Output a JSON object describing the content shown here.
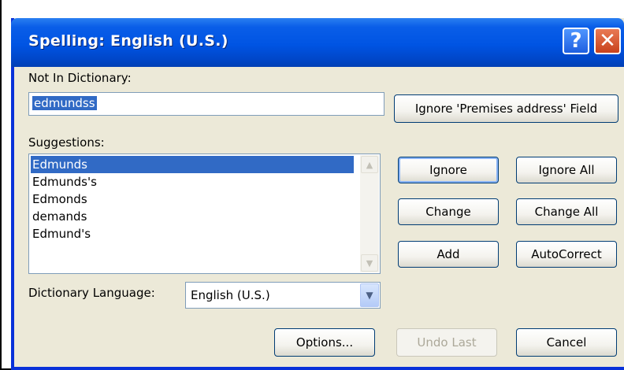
{
  "window": {
    "title": "Spelling: English (U.S.)",
    "help_glyph": "?",
    "close_glyph": "✕"
  },
  "not_in_dictionary": {
    "label": "Not In Dictionary:",
    "value": "edmundss"
  },
  "ignore_field_button": "Ignore 'Premises address' Field",
  "suggestions": {
    "label": "Suggestions:",
    "items": [
      "Edmunds",
      "Edmunds's",
      "Edmonds",
      "demands",
      "Edmund's"
    ],
    "selected": "Edmunds"
  },
  "buttons": {
    "ignore": "Ignore",
    "ignore_all": "Ignore All",
    "change": "Change",
    "change_all": "Change All",
    "add": "Add",
    "autocorrect": "AutoCorrect",
    "options": "Options...",
    "undo_last": "Undo Last",
    "cancel": "Cancel"
  },
  "dictionary_language": {
    "label": "Dictionary Language:",
    "value": "English (U.S.)"
  },
  "colors": {
    "title_bar": "#0054e3",
    "selection": "#316ac5",
    "dialog_bg": "#ece9d8",
    "close_button": "#c8421c"
  }
}
